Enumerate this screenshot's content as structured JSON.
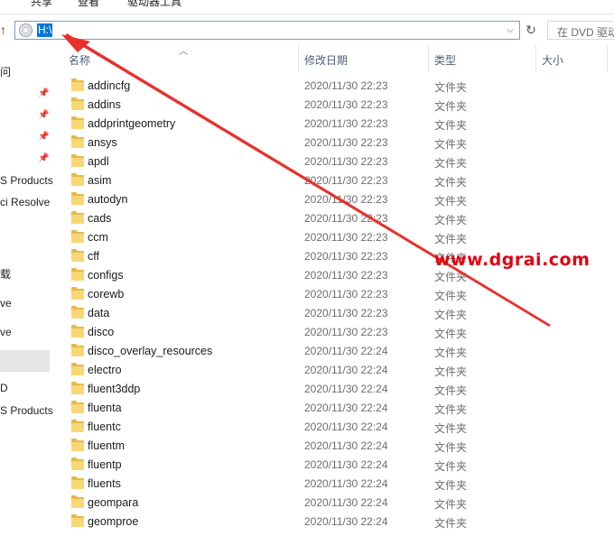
{
  "ribbon": {
    "tabs": [
      "共享",
      "查看",
      "驱动器工具"
    ]
  },
  "address_bar": {
    "path": "H:\\"
  },
  "search": {
    "placeholder": "在 DVD 驱动"
  },
  "nav_pane": {
    "items": [
      "问",
      "S Products",
      "ci Resolve",
      "载",
      "ve",
      "ve",
      "D",
      "S Products"
    ]
  },
  "columns": {
    "name": "名称",
    "date": "修改日期",
    "type": "类型",
    "size": "大小"
  },
  "files": [
    {
      "name": "addincfg",
      "date": "2020/11/30 22:23",
      "type": "文件夹"
    },
    {
      "name": "addins",
      "date": "2020/11/30 22:23",
      "type": "文件夹"
    },
    {
      "name": "addprintgeometry",
      "date": "2020/11/30 22:23",
      "type": "文件夹"
    },
    {
      "name": "ansys",
      "date": "2020/11/30 22:23",
      "type": "文件夹"
    },
    {
      "name": "apdl",
      "date": "2020/11/30 22:23",
      "type": "文件夹"
    },
    {
      "name": "asim",
      "date": "2020/11/30 22:23",
      "type": "文件夹"
    },
    {
      "name": "autodyn",
      "date": "2020/11/30 22:23",
      "type": "文件夹"
    },
    {
      "name": "cads",
      "date": "2020/11/30 22:23",
      "type": "文件夹"
    },
    {
      "name": "ccm",
      "date": "2020/11/30 22:23",
      "type": "文件夹"
    },
    {
      "name": "cff",
      "date": "2020/11/30 22:23",
      "type": "文件夹"
    },
    {
      "name": "configs",
      "date": "2020/11/30 22:23",
      "type": "文件夹"
    },
    {
      "name": "corewb",
      "date": "2020/11/30 22:23",
      "type": "文件夹"
    },
    {
      "name": "data",
      "date": "2020/11/30 22:23",
      "type": "文件夹"
    },
    {
      "name": "disco",
      "date": "2020/11/30 22:23",
      "type": "文件夹"
    },
    {
      "name": "disco_overlay_resources",
      "date": "2020/11/30 22:24",
      "type": "文件夹"
    },
    {
      "name": "electro",
      "date": "2020/11/30 22:24",
      "type": "文件夹"
    },
    {
      "name": "fluent3ddp",
      "date": "2020/11/30 22:24",
      "type": "文件夹"
    },
    {
      "name": "fluenta",
      "date": "2020/11/30 22:24",
      "type": "文件夹"
    },
    {
      "name": "fluentc",
      "date": "2020/11/30 22:24",
      "type": "文件夹"
    },
    {
      "name": "fluentm",
      "date": "2020/11/30 22:24",
      "type": "文件夹"
    },
    {
      "name": "fluentp",
      "date": "2020/11/30 22:24",
      "type": "文件夹"
    },
    {
      "name": "fluents",
      "date": "2020/11/30 22:24",
      "type": "文件夹"
    },
    {
      "name": "geompara",
      "date": "2020/11/30 22:24",
      "type": "文件夹"
    },
    {
      "name": "geomproe",
      "date": "2020/11/30 22:24",
      "type": "文件夹"
    }
  ],
  "watermark": {
    "text": "www.dgrai.com"
  },
  "colors": {
    "selection": "#0078d7",
    "annotation_arrow": "#e8312c",
    "watermark": "#e3000f",
    "folder": "#f8d775"
  }
}
